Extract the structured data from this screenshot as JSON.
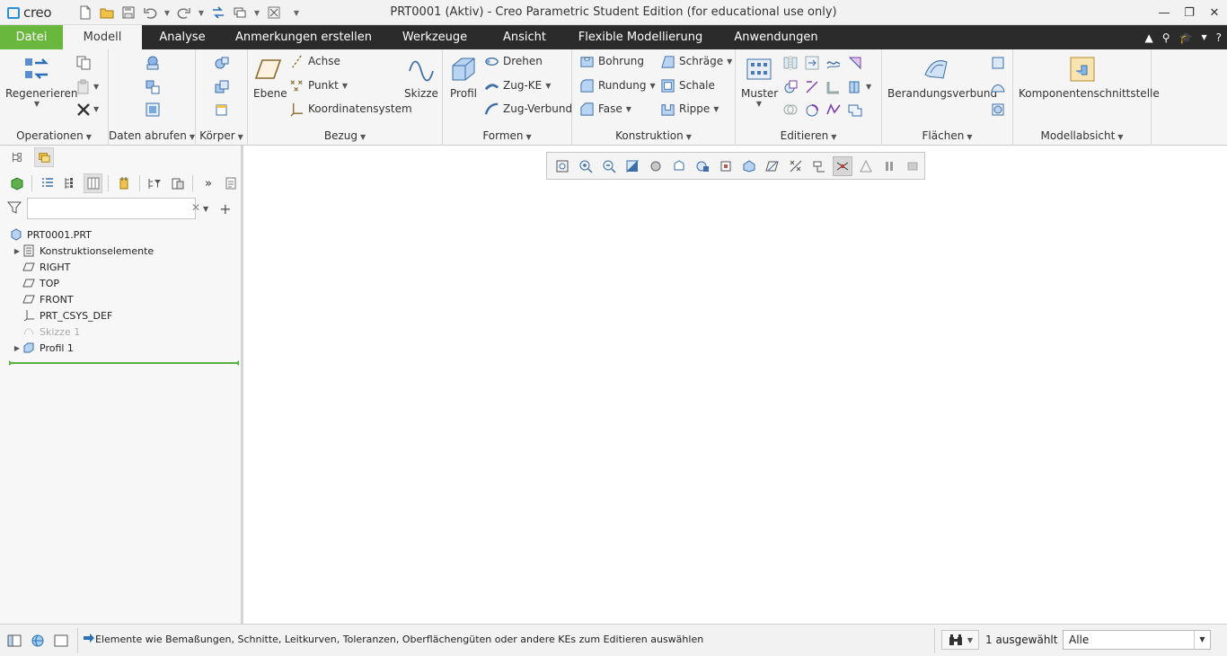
{
  "app": {
    "logo_text": "creo",
    "window_title": "PRT0001 (Aktiv) - Creo Parametric Student Edition (for educational use only)"
  },
  "tabs": [
    {
      "label": "Datei"
    },
    {
      "label": "Modell"
    },
    {
      "label": "Analyse"
    },
    {
      "label": "Anmerkungen erstellen"
    },
    {
      "label": "Werkzeuge"
    },
    {
      "label": "Ansicht"
    },
    {
      "label": "Flexible Modellierung"
    },
    {
      "label": "Anwendungen"
    }
  ],
  "active_tab": "Modell",
  "ribbon": {
    "operationen": {
      "label": "Operationen",
      "regenerieren": "Regenerieren"
    },
    "daten_abrufen": {
      "label": "Daten abrufen"
    },
    "koerper": {
      "label": "Körper"
    },
    "bezug": {
      "label": "Bezug",
      "ebene": "Ebene",
      "achse": "Achse",
      "punkt": "Punkt",
      "koordinatensystem": "Koordinatensystem",
      "skizze": "Skizze"
    },
    "formen": {
      "label": "Formen",
      "profil": "Profil",
      "drehen": "Drehen",
      "zug_ke": "Zug-KE",
      "zug_verbund": "Zug-Verbund"
    },
    "konstruktion": {
      "label": "Konstruktion",
      "bohrung": "Bohrung",
      "rundung": "Rundung",
      "fase": "Fase",
      "schraege": "Schräge",
      "schale": "Schale",
      "rippe": "Rippe"
    },
    "editieren": {
      "label": "Editieren",
      "muster": "Muster"
    },
    "flaechen": {
      "label": "Flächen",
      "berandungsverbund": "Berandungsverbund"
    },
    "modellabsicht": {
      "label": "Modellabsicht",
      "komponentenschnittstelle": "Komponentenschnittstelle"
    }
  },
  "model_tree": {
    "search_placeholder": "",
    "items": [
      {
        "label": "PRT0001.PRT",
        "icon": "part-icon"
      },
      {
        "label": "Konstruktionselemente",
        "icon": "layers-icon"
      },
      {
        "label": "RIGHT",
        "icon": "datum-plane-icon"
      },
      {
        "label": "TOP",
        "icon": "datum-plane-icon"
      },
      {
        "label": "FRONT",
        "icon": "datum-plane-icon"
      },
      {
        "label": "PRT_CSYS_DEF",
        "icon": "csys-icon"
      },
      {
        "label": "Skizze 1",
        "icon": "sketch-icon"
      },
      {
        "label": "Profil 1",
        "icon": "extrude-icon"
      }
    ]
  },
  "status": {
    "message": "Elemente wie Bemaßungen, Schnitte, Leitkurven, Toleranzen, Oberflächengüten oder andere KEs zum Editieren auswählen",
    "selected": "1 ausgewählt",
    "filter": "Alle"
  },
  "colors": {
    "datei_tab": "#69b83d",
    "tabbar": "#2b2b2b",
    "accent_blue": "#2a8fd6"
  }
}
